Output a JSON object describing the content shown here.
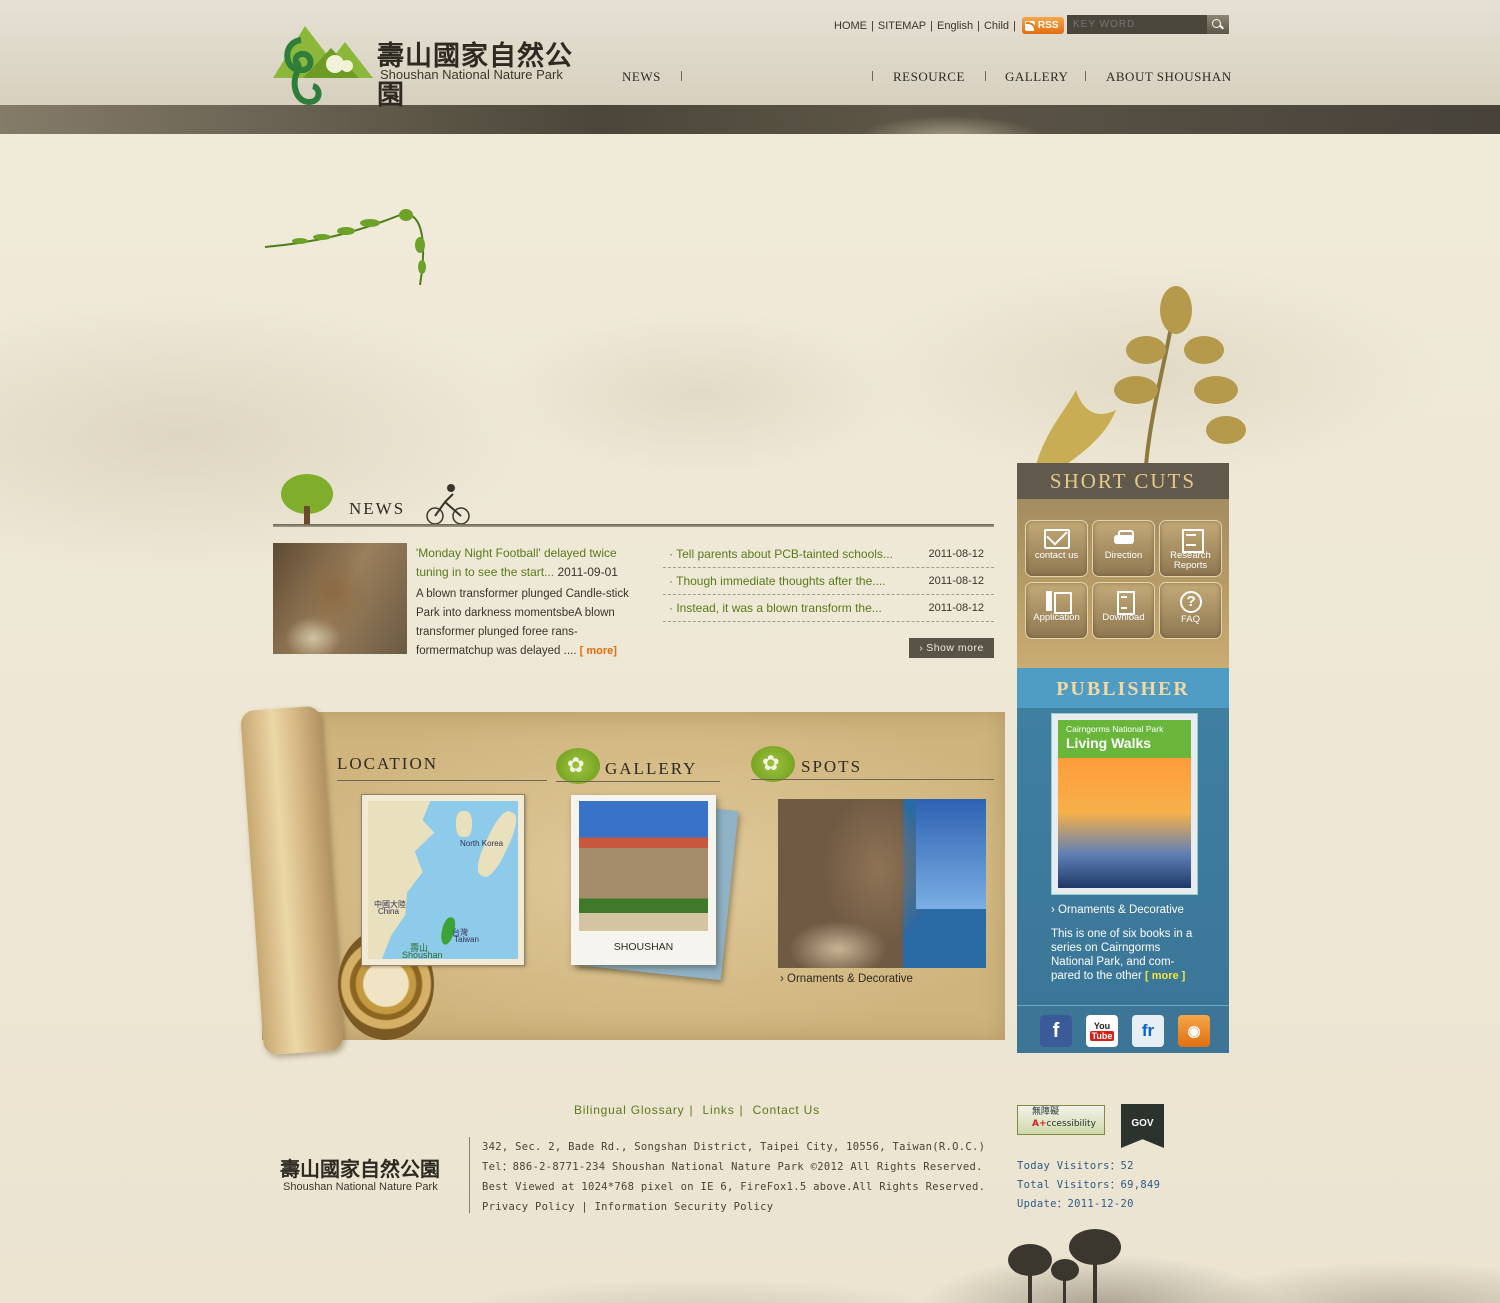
{
  "site": {
    "logo_cn": "壽山國家自然公園",
    "logo_en": "Shoushan National Nature Park"
  },
  "toplinks": [
    "HOME",
    "SITEMAP",
    "English",
    "Child"
  ],
  "rss_label": "RSS",
  "search": {
    "placeholder": "KEY WORD"
  },
  "nav": [
    "NEWS",
    "RESOURCE",
    "GALLERY",
    "ABOUT SHOUSHAN"
  ],
  "news": {
    "title": "NEWS",
    "featured": {
      "title": "'Monday Night Football' delayed twice tuning in to see the start...",
      "date": "2011-09-01",
      "body": "A blown transformer plunged Candle-stick Park into darkness momentsbeA blown transformer plunged foree rans-formermatchup was delayed ....",
      "more": "[ more]"
    },
    "items": [
      {
        "title": "Tell parents about PCB-tainted schools...",
        "date": "2011-08-12"
      },
      {
        "title": "Though immediate thoughts after the....",
        "date": "2011-08-12"
      },
      {
        "title": "Instead, it was a blown transform  the...",
        "date": "2011-08-12"
      }
    ],
    "show_more": "Show more"
  },
  "location": {
    "title": "LOCATION",
    "map_labels": {
      "china_cn": "中國大陸",
      "china_en": "China",
      "taiwan_cn": "台灣",
      "taiwan_en": "Taiwan",
      "korea": "North Korea",
      "shoushan_cn": "壽山",
      "shoushan_en": "Shoushan"
    }
  },
  "gallery": {
    "title": "GALLERY",
    "caption": "SHOUSHAN"
  },
  "spots": {
    "title": "SPOTS",
    "caption": "Ornaments & Decorative"
  },
  "shortcuts": {
    "title": "SHORT CUTS",
    "buttons": [
      {
        "label": "contact us",
        "icon": "mail-icon"
      },
      {
        "label": "Direction",
        "icon": "car-icon"
      },
      {
        "label": "Research Reports",
        "icon": "report-icon"
      },
      {
        "label": "Application",
        "icon": "form-icon"
      },
      {
        "label": "Download",
        "icon": "download-icon"
      },
      {
        "label": "FAQ",
        "icon": "question-icon"
      }
    ]
  },
  "publisher": {
    "title": "PUBLISHER",
    "book_small": "Cairngorms National Park",
    "book_big": "Living Walks",
    "caption": "Ornaments & Decorative",
    "text": "This is one of six books in a series on Cairngorms National Park, and com-pared to the other",
    "more": "[ more ]"
  },
  "social": [
    "facebook-icon",
    "youtube-icon",
    "flickr-icon",
    "rss-icon"
  ],
  "footer": {
    "links": [
      "Bilingual Glossary",
      "Links",
      "Contact Us"
    ],
    "logo_cn": "壽山國家自然公園",
    "logo_en": "Shoushan National Nature Park",
    "lines": [
      "342, Sec. 2, Bade Rd., Songshan District, Taipei City, 10556, Taiwan(R.O.C.)",
      "Tel：886-2-8771-234   Shoushan National Nature Park  ©2012  All Rights Reserved.",
      "Best Viewed at 1024*768 pixel on IE 6, FireFox1.5 above.All Rights Reserved.",
      "Privacy Policy  |  Information Security Policy"
    ],
    "accessibility_badge": {
      "line1": "無障礙",
      "line2": "A+",
      "line3": "ccessibility"
    },
    "gov_badge": "GOV",
    "stats": [
      "Today Visitors：52",
      "Total Visitors：69,849",
      "Update：2011-12-20"
    ]
  }
}
